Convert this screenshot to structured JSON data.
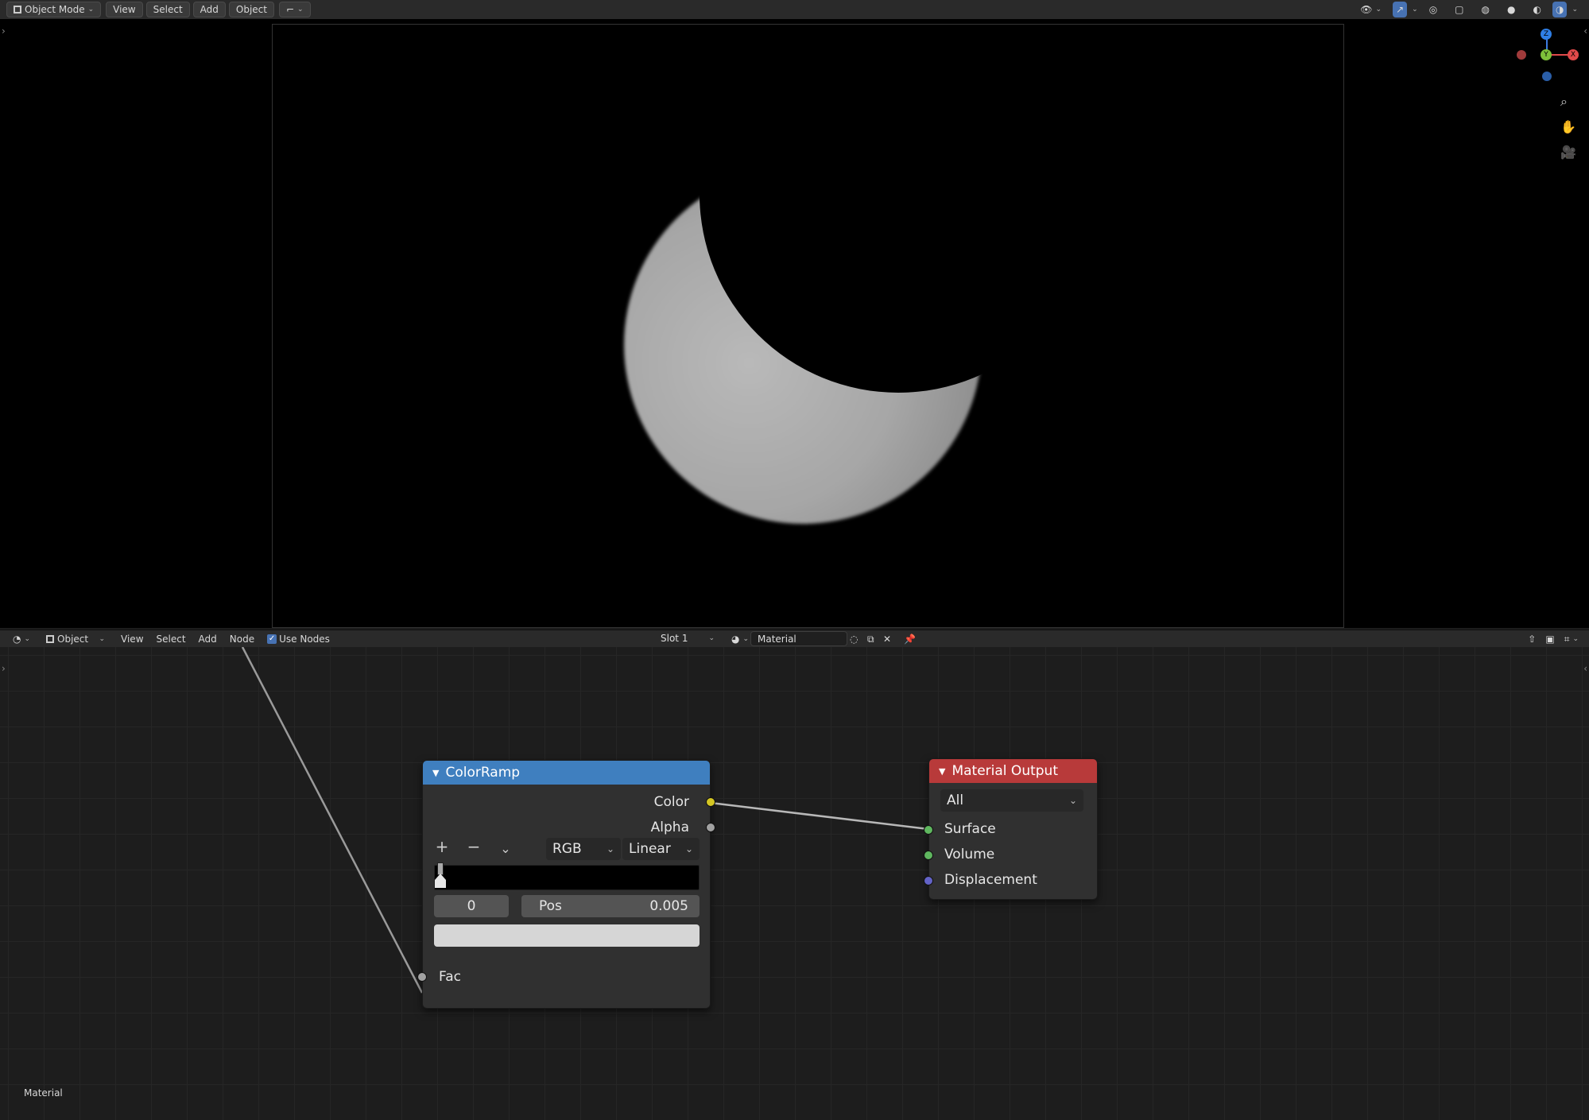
{
  "viewport_header": {
    "mode": "Object Mode",
    "menus": [
      "View",
      "Select",
      "Add",
      "Object"
    ]
  },
  "node_header": {
    "editor_type": "Object",
    "menus": [
      "View",
      "Select",
      "Add",
      "Node"
    ],
    "use_nodes_label": "Use Nodes",
    "use_nodes_checked": true,
    "slot": "Slot 1",
    "material_name": "Material"
  },
  "gizmo": {
    "z": "Z",
    "y": "Y",
    "x": "X"
  },
  "colorramp_node": {
    "title": "ColorRamp",
    "outputs": {
      "color": "Color",
      "alpha": "Alpha"
    },
    "color_mode": "RGB",
    "interpolation": "Linear",
    "stop_index": "0",
    "pos_label": "Pos",
    "pos_value": "0.005",
    "input_fac": "Fac"
  },
  "material_output_node": {
    "title": "Material Output",
    "target": "All",
    "inputs": {
      "surface": "Surface",
      "volume": "Volume",
      "displacement": "Displacement"
    }
  },
  "footer_label": "Material",
  "colors": {
    "colorramp_header": "#3f7fbf",
    "material_output_header": "#b83a3a",
    "socket_color": "#d4c623",
    "socket_gray": "#a1a1a1",
    "socket_shader": "#5fb75f",
    "socket_vector": "#6363c7"
  }
}
